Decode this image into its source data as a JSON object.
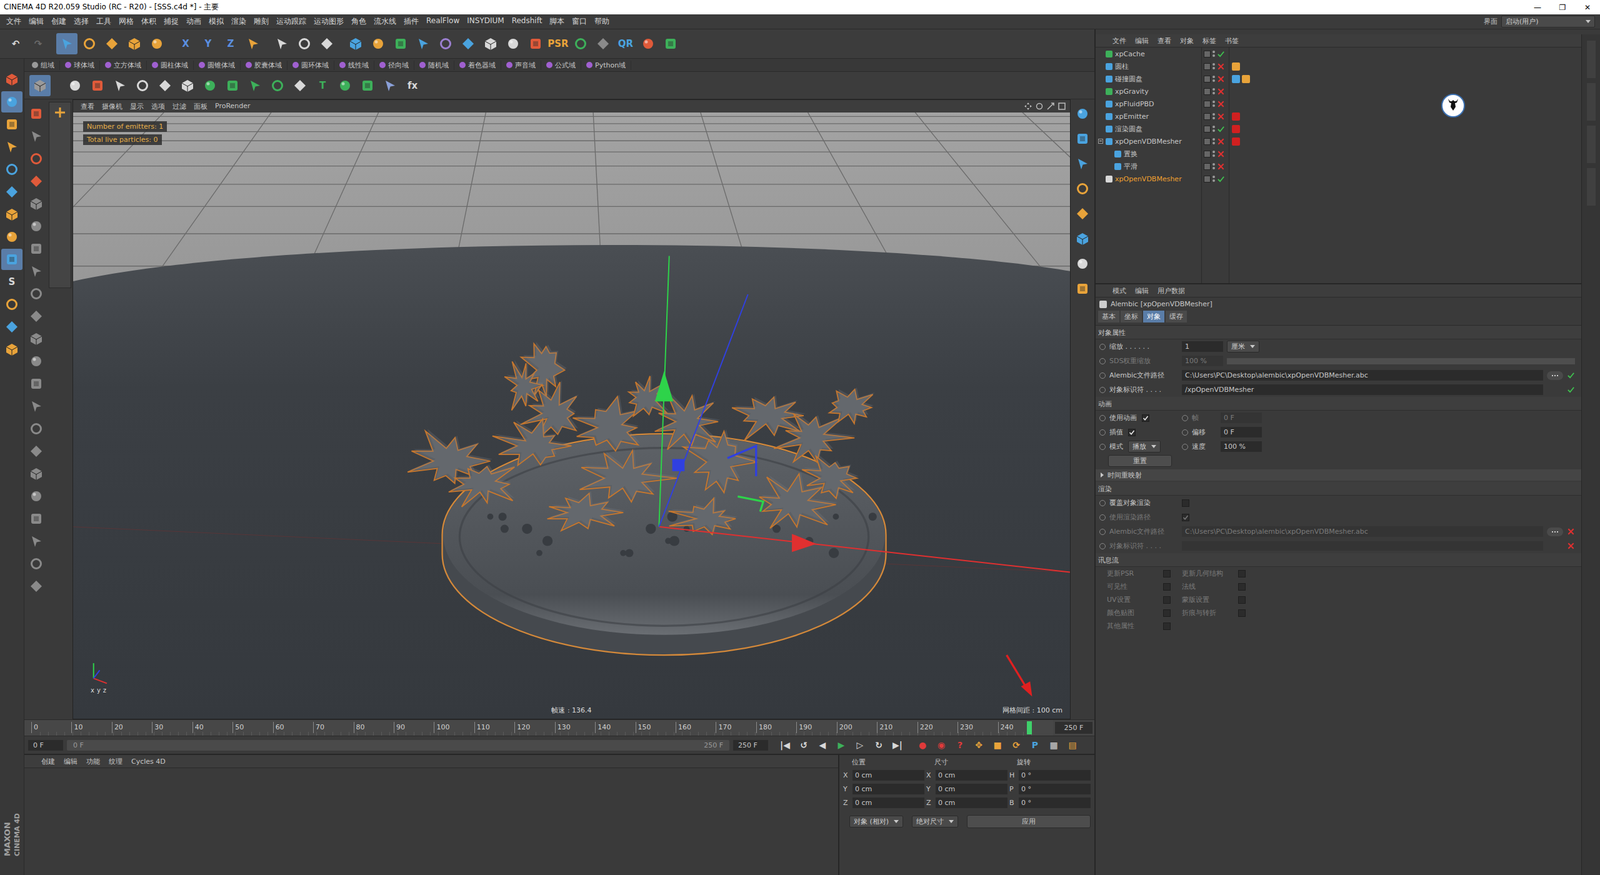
{
  "window": {
    "title": "CINEMA 4D R20.059 Studio (RC - R20) - [SSS.c4d *] - 主要",
    "controls": [
      "—",
      "❐",
      "✕"
    ]
  },
  "menu": [
    "文件",
    "编辑",
    "创建",
    "选择",
    "工具",
    "网格",
    "体积",
    "捕捉",
    "动画",
    "模拟",
    "渲染",
    "雕刻",
    "运动跟踪",
    "运动图形",
    "角色",
    "流水线",
    "插件",
    "RealFlow",
    "INSYDIUM",
    "Redshift",
    "脚本",
    "窗口",
    "帮助"
  ],
  "layout_selector": {
    "label": "界面",
    "value": "启动(用户)"
  },
  "main_toolbar": [
    [
      {
        "glyph": "↶",
        "color": "#d8d8d8",
        "selected": false
      },
      {
        "glyph": "↷",
        "color": "#6a6a6a",
        "selected": false
      }
    ],
    [
      {
        "glyph": "",
        "color": "#4aa3df",
        "selected": true
      },
      {
        "glyph": "",
        "color": "#e8a33a",
        "selected": false
      },
      {
        "glyph": "",
        "color": "#e8a33a",
        "selected": false
      },
      {
        "glyph": "",
        "color": "#e8a33a",
        "selected": false
      },
      {
        "glyph": "",
        "color": "#e8a33a",
        "selected": false
      }
    ],
    [
      {
        "glyph": "X",
        "color": "#5b8fe0",
        "selected": false
      },
      {
        "glyph": "Y",
        "color": "#5b8fe0",
        "selected": false
      },
      {
        "glyph": "Z",
        "color": "#5b8fe0",
        "selected": false
      },
      {
        "glyph": "",
        "color": "#e8a33a",
        "selected": false
      }
    ],
    [
      {
        "glyph": "",
        "color": "#d8d8d8",
        "selected": false
      },
      {
        "glyph": "",
        "color": "#d8d8d8",
        "selected": false
      },
      {
        "glyph": "",
        "color": "#d8d8d8",
        "selected": false
      }
    ],
    [
      {
        "glyph": "",
        "color": "#4aa3df",
        "selected": false
      },
      {
        "glyph": "",
        "color": "#e8a33a",
        "selected": false
      },
      {
        "glyph": "",
        "color": "#3db05a",
        "selected": false
      },
      {
        "glyph": "",
        "color": "#4aa3df",
        "selected": false
      },
      {
        "glyph": "",
        "color": "#9b7fd0",
        "selected": false
      },
      {
        "glyph": "",
        "color": "#4aa3df",
        "selected": false
      },
      {
        "glyph": "",
        "color": "#d8d8d8",
        "selected": false
      },
      {
        "glyph": "",
        "color": "#d8d8d8",
        "selected": false
      },
      {
        "glyph": "",
        "color": "#e05a3a",
        "selected": false
      },
      {
        "glyph": "PSR",
        "color": "#e8a33a",
        "selected": false
      },
      {
        "glyph": "",
        "color": "#3db05a",
        "selected": false
      },
      {
        "glyph": "",
        "color": "#8a8a8a",
        "selected": false
      },
      {
        "glyph": "QR",
        "color": "#4aa3df",
        "selected": false
      },
      {
        "glyph": "",
        "color": "#e05a3a",
        "selected": false
      },
      {
        "glyph": "",
        "color": "#3db05a",
        "selected": false
      }
    ]
  ],
  "fields_bar": [
    {
      "label": "组域",
      "color": "#9a9a9a"
    },
    {
      "label": "球体域",
      "color": "#a060d0"
    },
    {
      "label": "立方体域",
      "color": "#a060d0"
    },
    {
      "label": "圆柱体域",
      "color": "#a060d0"
    },
    {
      "label": "圆锥体域",
      "color": "#a060d0"
    },
    {
      "label": "胶囊体域",
      "color": "#a060d0"
    },
    {
      "label": "圆环体域",
      "color": "#a060d0"
    },
    {
      "label": "线性域",
      "color": "#a060d0"
    },
    {
      "label": "径向域",
      "color": "#a060d0"
    },
    {
      "label": "随机域",
      "color": "#a060d0"
    },
    {
      "label": "着色器域",
      "color": "#a060d0"
    },
    {
      "label": "声音域",
      "color": "#a060d0"
    },
    {
      "label": "公式域",
      "color": "#a060d0"
    },
    {
      "label": "Python域",
      "color": "#a060d0"
    }
  ],
  "tools_bar": [
    [
      {
        "glyph": "",
        "color": "#9a9a9a",
        "selected": true
      }
    ],
    [
      {
        "glyph": "",
        "color": "#d8d8d8",
        "selected": false
      },
      {
        "glyph": "",
        "color": "#e05a3a",
        "selected": false
      },
      {
        "glyph": "",
        "color": "#d8d8d8",
        "selected": false
      },
      {
        "glyph": "",
        "color": "#d8d8d8",
        "selected": false
      },
      {
        "glyph": "",
        "color": "#d8d8d8",
        "selected": false
      },
      {
        "glyph": "",
        "color": "#d8d8d8",
        "selected": false
      },
      {
        "glyph": "",
        "color": "#3db05a",
        "selected": false
      },
      {
        "glyph": "",
        "color": "#3db05a",
        "selected": false
      },
      {
        "glyph": "",
        "color": "#3db05a",
        "selected": false
      },
      {
        "glyph": "",
        "color": "#3db05a",
        "selected": false
      },
      {
        "glyph": "",
        "color": "#d8d8d8",
        "selected": false
      },
      {
        "glyph": "T",
        "color": "#3db05a",
        "selected": false
      },
      {
        "glyph": "",
        "color": "#3db05a",
        "selected": false
      },
      {
        "glyph": "",
        "color": "#3db05a",
        "selected": false
      },
      {
        "glyph": "",
        "color": "#8aa0d8",
        "selected": false
      },
      {
        "glyph": "fx",
        "color": "#d8d8d8",
        "selected": false
      }
    ]
  ],
  "left_tools": [
    {
      "glyph": "",
      "color": "#e05a3a",
      "selected": false
    },
    {
      "glyph": "",
      "color": "#4aa3df",
      "selected": true
    },
    {
      "glyph": "",
      "color": "#e8a33a",
      "selected": false
    },
    {
      "glyph": "",
      "color": "#e8a33a",
      "selected": false
    },
    {
      "glyph": "",
      "color": "#4aa3df",
      "selected": false
    },
    {
      "glyph": "",
      "color": "#4aa3df",
      "selected": false
    },
    {
      "glyph": "",
      "color": "#e8a33a",
      "selected": false
    },
    {
      "glyph": "",
      "color": "#e8a33a",
      "selected": false
    },
    {
      "glyph": "",
      "color": "#4aa3df",
      "selected": true
    },
    {
      "glyph": "S",
      "color": "#d8d8d8",
      "selected": false
    },
    {
      "glyph": "",
      "color": "#e8a33a",
      "selected": false
    },
    {
      "glyph": "",
      "color": "#4aa3df",
      "selected": false
    },
    {
      "glyph": "",
      "color": "#e8a33a",
      "selected": false
    }
  ],
  "palette_tools": [
    {
      "glyph": "",
      "color": "#e05a3a",
      "selected": false
    },
    {
      "glyph": "",
      "color": "#8a8a8a",
      "selected": false
    },
    {
      "glyph": "",
      "color": "#e05a3a",
      "selected": false
    },
    {
      "glyph": "",
      "color": "#e05a3a",
      "selected": false
    },
    {
      "glyph": "",
      "color": "#8a8a8a",
      "selected": false
    },
    {
      "glyph": "",
      "color": "#8a8a8a",
      "selected": false
    },
    {
      "glyph": "",
      "color": "#8a8a8a",
      "selected": false
    },
    {
      "glyph": "",
      "color": "#8a8a8a",
      "selected": false
    },
    {
      "glyph": "",
      "color": "#8a8a8a",
      "selected": false
    },
    {
      "glyph": "",
      "color": "#8a8a8a",
      "selected": false
    },
    {
      "glyph": "",
      "color": "#8a8a8a",
      "selected": false
    },
    {
      "glyph": "",
      "color": "#8a8a8a",
      "selected": false
    },
    {
      "glyph": "",
      "color": "#8a8a8a",
      "selected": false
    },
    {
      "glyph": "",
      "color": "#8a8a8a",
      "selected": false
    },
    {
      "glyph": "",
      "color": "#8a8a8a",
      "selected": false
    },
    {
      "glyph": "",
      "color": "#8a8a8a",
      "selected": false
    },
    {
      "glyph": "",
      "color": "#8a8a8a",
      "selected": false
    },
    {
      "glyph": "",
      "color": "#8a8a8a",
      "selected": false
    },
    {
      "glyph": "",
      "color": "#8a8a8a",
      "selected": false
    },
    {
      "glyph": "",
      "color": "#8a8a8a",
      "selected": false
    },
    {
      "glyph": "",
      "color": "#8a8a8a",
      "selected": false
    },
    {
      "glyph": "",
      "color": "#8a8a8a",
      "selected": false
    }
  ],
  "viewport": {
    "menu": [
      "查看",
      "摄像机",
      "显示",
      "选项",
      "过滤",
      "面板",
      "ProRender"
    ],
    "hud": [
      "Number of emitters: 1",
      "Total live particles: 0"
    ],
    "fps": "帧速 : 136.4",
    "grid": "网格间距 : 100 cm",
    "axis_labels": [
      "x",
      "y",
      "z"
    ]
  },
  "viewport_side_tools": [
    {
      "glyph": "",
      "color": "#4aa3df",
      "selected": false
    },
    {
      "glyph": "",
      "color": "#4aa3df",
      "selected": false
    },
    {
      "glyph": "",
      "color": "#4aa3df",
      "selected": false
    },
    {
      "glyph": "",
      "color": "#e8a33a",
      "selected": false
    },
    {
      "glyph": "",
      "color": "#e8a33a",
      "selected": false
    },
    {
      "glyph": "",
      "color": "#4aa3df",
      "selected": false
    },
    {
      "glyph": "",
      "color": "#d8d8d8",
      "selected": false
    },
    {
      "glyph": "",
      "color": "#e8a33a",
      "selected": false
    }
  ],
  "object_manager": {
    "menu": [
      "文件",
      "编辑",
      "查看",
      "对象",
      "标签",
      "书签"
    ],
    "objects": [
      {
        "name": "xpCache",
        "depth": 0,
        "expandable": false,
        "expanded": false,
        "enabled": true,
        "selected": false,
        "color": "#3db05a",
        "tags": []
      },
      {
        "name": "圆柱",
        "depth": 0,
        "expandable": false,
        "expanded": false,
        "enabled": false,
        "selected": false,
        "color": "#4aa3df",
        "tags": [
          "#e8a33a"
        ]
      },
      {
        "name": "碰撞圆盘",
        "depth": 0,
        "expandable": false,
        "expanded": false,
        "enabled": false,
        "selected": false,
        "color": "#4aa3df",
        "tags": [
          "#4aa3df",
          "#e8a33a"
        ]
      },
      {
        "name": "xpGravity",
        "depth": 0,
        "expandable": false,
        "expanded": false,
        "enabled": false,
        "selected": false,
        "color": "#3db05a",
        "tags": []
      },
      {
        "name": "xpFluidPBD",
        "depth": 0,
        "expandable": false,
        "expanded": false,
        "enabled": false,
        "selected": false,
        "color": "#4aa3df",
        "tags": []
      },
      {
        "name": "xpEmitter",
        "depth": 0,
        "expandable": false,
        "expanded": false,
        "enabled": false,
        "selected": false,
        "color": "#4aa3df",
        "tags": [
          "#d02020"
        ]
      },
      {
        "name": "渲染圆盘",
        "depth": 0,
        "expandable": false,
        "expanded": false,
        "enabled": true,
        "selected": false,
        "color": "#4aa3df",
        "tags": [
          "#d02020"
        ]
      },
      {
        "name": "xpOpenVDBMesher",
        "depth": 0,
        "expandable": true,
        "expanded": true,
        "enabled": false,
        "selected": false,
        "color": "#4aa3df",
        "tags": [
          "#d02020"
        ]
      },
      {
        "name": "置换",
        "depth": 1,
        "expandable": false,
        "expanded": false,
        "enabled": false,
        "selected": false,
        "color": "#4aa3df",
        "tags": []
      },
      {
        "name": "平滑",
        "depth": 1,
        "expandable": false,
        "expanded": false,
        "enabled": false,
        "selected": false,
        "color": "#4aa3df",
        "tags": []
      },
      {
        "name": "xpOpenVDBMesher",
        "depth": 0,
        "expandable": false,
        "expanded": false,
        "enabled": true,
        "selected": true,
        "color": "#d8d8d8",
        "tags": []
      }
    ]
  },
  "attribute_manager": {
    "menu": [
      "模式",
      "编辑",
      "用户数据"
    ],
    "title": "Alembic [xpOpenVDBMesher]",
    "tabs": [
      {
        "label": "基本",
        "selected": false
      },
      {
        "label": "坐标",
        "selected": false
      },
      {
        "label": "对象",
        "selected": true
      },
      {
        "label": "缓存",
        "selected": false
      }
    ],
    "sections": [
      {
        "title": "对象属性",
        "rows": [
          {
            "kind": "number",
            "label": "缩放 . . . . . .",
            "value": "1",
            "unit": "厘米",
            "disabled": false
          },
          {
            "kind": "slider",
            "label": "SDS权重缩放",
            "value": "100 %",
            "level": 1,
            "disabled": true
          },
          {
            "kind": "path",
            "label": "Alembic文件路径",
            "value": "C:\\Users\\PC\\Desktop\\alembic\\xpOpenVDBMesher.abc",
            "valid": true,
            "disabled": false
          },
          {
            "kind": "text",
            "label": "对象标识符 . . . .",
            "value": "/xpOpenVDBMesher",
            "valid": true,
            "disabled": false
          }
        ]
      },
      {
        "title": "动画",
        "rows": [
          {
            "kind": "pair",
            "left": {
              "label": "使用动画",
              "control": "check",
              "checked": true,
              "value": ""
            },
            "right": {
              "label": "帧",
              "value": "0 F",
              "disabled": true
            }
          },
          {
            "kind": "pair",
            "left": {
              "label": "插值",
              "control": "check",
              "checked": true,
              "value": ""
            },
            "right": {
              "label": "偏移",
              "value": "0 F",
              "disabled": false
            }
          },
          {
            "kind": "pair",
            "left": {
              "label": "模式",
              "control": "select",
              "checked": false,
              "value": "播放"
            },
            "right": {
              "label": "速度",
              "value": "100 %",
              "disabled": false
            }
          },
          {
            "kind": "button",
            "label": "重置"
          },
          {
            "kind": "group",
            "label": "时间重映射",
            "expanded": false
          }
        ]
      },
      {
        "title": "渲染",
        "rows": [
          {
            "kind": "check",
            "label": "覆盖对象渲染",
            "checked": false,
            "disabled": false
          },
          {
            "kind": "check",
            "label": "使用渲染路径",
            "checked": true,
            "disabled": true
          },
          {
            "kind": "path",
            "label": "Alembic文件路径",
            "value": "C:\\Users\\PC\\Desktop\\alembic\\xpOpenVDBMesher.abc",
            "valid": false,
            "disabled": true
          },
          {
            "kind": "text",
            "label": "对象标识符 . . . .",
            "value": "",
            "valid": false,
            "disabled": true
          }
        ]
      },
      {
        "title": "讯息流",
        "rows": [
          {
            "kind": "checkgrid",
            "items": [
              {
                "label": "更新PSR",
                "checked": false,
                "disabled": true
              },
              {
                "label": "更新几何结构",
                "checked": false,
                "disabled": true
              },
              {
                "label": "可见性",
                "checked": false,
                "disabled": true
              },
              {
                "label": "法线",
                "checked": false,
                "disabled": true
              },
              {
                "label": "UV设置",
                "checked": false,
                "disabled": true
              },
              {
                "label": "蒙版设置",
                "checked": false,
                "disabled": true
              },
              {
                "label": "颜色贴图",
                "checked": false,
                "disabled": true
              },
              {
                "label": "折痕与转折",
                "checked": false,
                "disabled": true
              },
              {
                "label": "其他属性",
                "checked": false,
                "disabled": true
              }
            ]
          }
        ]
      }
    ]
  },
  "timeline": {
    "ticks": [
      "0",
      "10",
      "20",
      "30",
      "40",
      "50",
      "60",
      "70",
      "80",
      "90",
      "100",
      "110",
      "120",
      "130",
      "140",
      "150",
      "160",
      "170",
      "180",
      "190",
      "200",
      "210",
      "220",
      "230",
      "240"
    ],
    "end": "250 F",
    "playhead": 0.99
  },
  "transport": {
    "start": "0 F",
    "range_start": "0 F",
    "range_end": "250 F",
    "end": "250 F",
    "buttons": [
      {
        "glyph": "|◀",
        "color": "#d8d8d8"
      },
      {
        "glyph": "↺",
        "color": "#d8d8d8"
      },
      {
        "glyph": "◀",
        "color": "#d8d8d8"
      },
      {
        "glyph": "▶",
        "color": "#3db05a"
      },
      {
        "glyph": "▷",
        "color": "#d8d8d8"
      },
      {
        "glyph": "↻",
        "color": "#d8d8d8"
      },
      {
        "glyph": "▶|",
        "color": "#d8d8d8"
      }
    ],
    "record": [
      {
        "glyph": "●",
        "color": "#e03a3a"
      },
      {
        "glyph": "◉",
        "color": "#e03a3a"
      },
      {
        "glyph": "?",
        "color": "#e03a3a"
      },
      {
        "glyph": "✥",
        "color": "#e8a33a"
      },
      {
        "glyph": "■",
        "color": "#e8a33a"
      },
      {
        "glyph": "⟳",
        "color": "#e8a33a"
      },
      {
        "glyph": "P",
        "color": "#4aa3df"
      },
      {
        "glyph": "▦",
        "color": "#d8d8d8"
      },
      {
        "glyph": "▤",
        "color": "#e8a33a"
      }
    ]
  },
  "material_manager": {
    "menu": [
      "创建",
      "编辑",
      "功能",
      "纹理",
      "Cycles 4D"
    ]
  },
  "coordinates": {
    "headers": [
      "位置",
      "尺寸",
      "旋转"
    ],
    "rows": [
      {
        "axes": [
          "X",
          "X",
          "H"
        ],
        "values": [
          "0 cm",
          "0 cm",
          "0 °"
        ]
      },
      {
        "axes": [
          "Y",
          "Y",
          "P"
        ],
        "values": [
          "0 cm",
          "0 cm",
          "0 °"
        ]
      },
      {
        "axes": [
          "Z",
          "Z",
          "B"
        ],
        "values": [
          "0 cm",
          "0 cm",
          "0 °"
        ]
      }
    ],
    "mode": "对象 (相对)",
    "size_mode": "绝对尺寸",
    "apply": "应用"
  },
  "logo": [
    "MAXON",
    "CINEMA 4D"
  ]
}
